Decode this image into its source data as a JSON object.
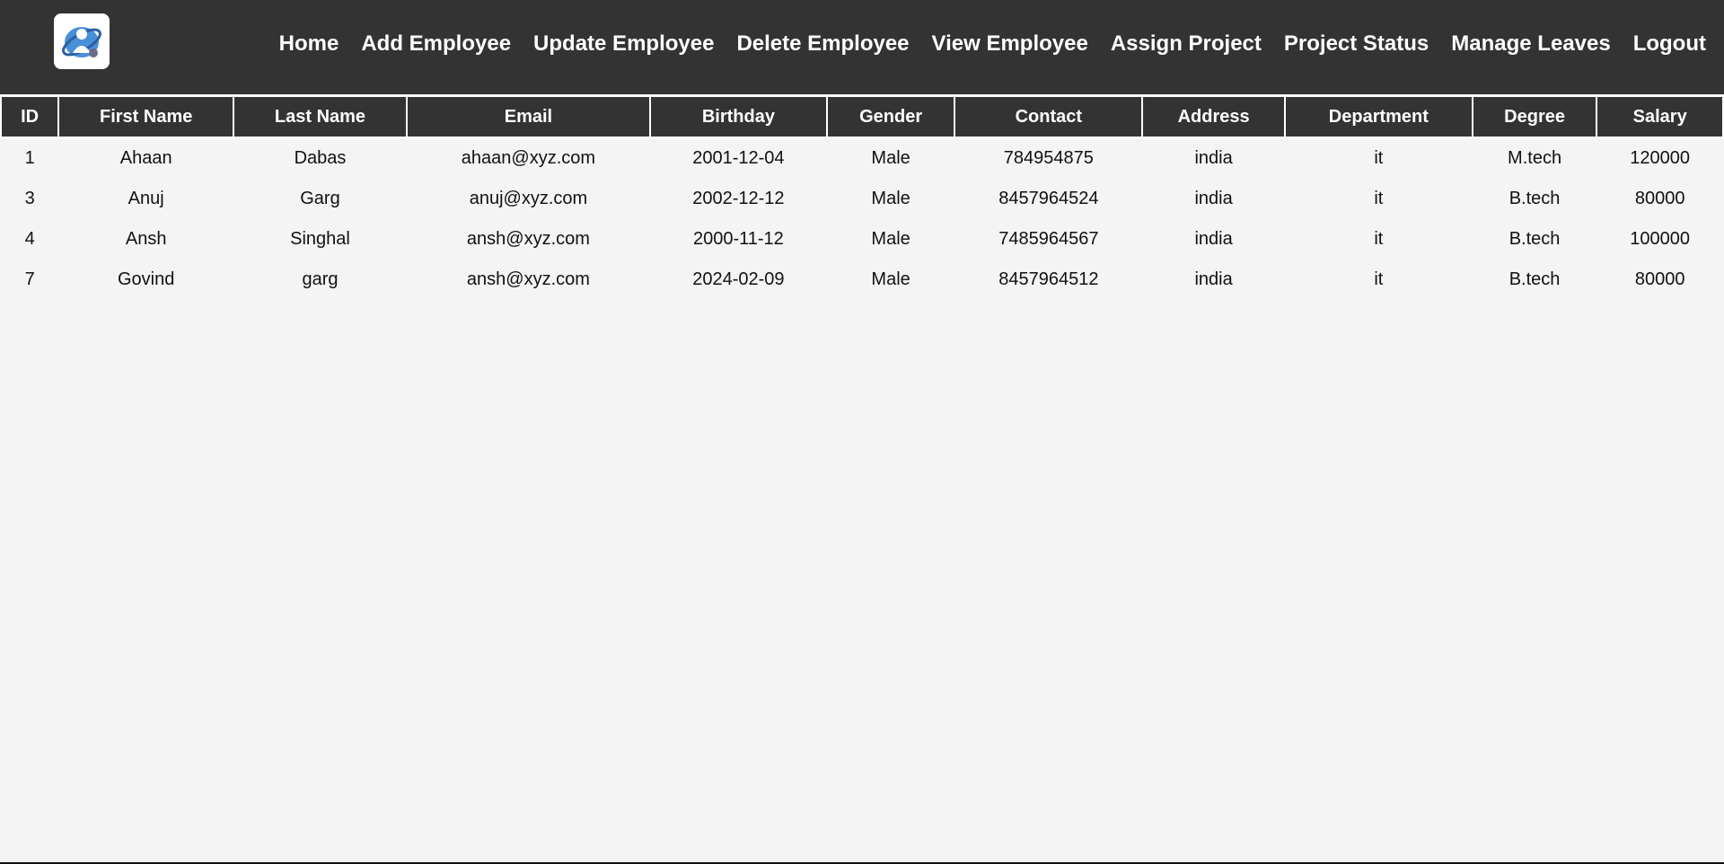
{
  "nav": {
    "logo_icon": "employee-globe-logo",
    "links": [
      {
        "label": "Home"
      },
      {
        "label": "Add Employee"
      },
      {
        "label": "Update Employee"
      },
      {
        "label": "Delete Employee"
      },
      {
        "label": "View Employee"
      },
      {
        "label": "Assign Project"
      },
      {
        "label": "Project Status"
      },
      {
        "label": "Manage Leaves"
      },
      {
        "label": "Logout"
      }
    ]
  },
  "table": {
    "headers": [
      "ID",
      "First Name",
      "Last Name",
      "Email",
      "Birthday",
      "Gender",
      "Contact",
      "Address",
      "Department",
      "Degree",
      "Salary"
    ],
    "rows": [
      [
        "1",
        "Ahaan",
        "Dabas",
        "ahaan@xyz.com",
        "2001-12-04",
        "Male",
        "784954875",
        "india",
        "it",
        "M.tech",
        "120000"
      ],
      [
        "3",
        "Anuj",
        "Garg",
        "anuj@xyz.com",
        "2002-12-12",
        "Male",
        "8457964524",
        "india",
        "it",
        "B.tech",
        "80000"
      ],
      [
        "4",
        "Ansh",
        "Singhal",
        "ansh@xyz.com",
        "2000-11-12",
        "Male",
        "7485964567",
        "india",
        "it",
        "B.tech",
        "100000"
      ],
      [
        "7",
        "Govind",
        "garg",
        "ansh@xyz.com",
        "2024-02-09",
        "Male",
        "8457964512",
        "india",
        "it",
        "B.tech",
        "80000"
      ]
    ]
  },
  "colors": {
    "navbar_bg": "#333333",
    "page_bg": "#f4f4f4",
    "header_text": "#ffffff"
  }
}
